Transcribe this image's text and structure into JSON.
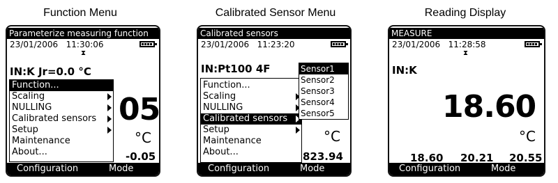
{
  "panels": [
    {
      "caption": "Function  Menu",
      "title": "Parameterize measuring function",
      "date": "23/01/2006",
      "time": "11:30:06",
      "input_line": "IN:K Jr=0.0 °C",
      "menu": [
        {
          "label": "Function...",
          "selected": true,
          "arrow": false
        },
        {
          "label": "Scaling",
          "selected": false,
          "arrow": true
        },
        {
          "label": "NULLING",
          "selected": false,
          "arrow": true
        },
        {
          "label": "Calibrated sensors",
          "selected": false,
          "arrow": true
        },
        {
          "label": "Setup",
          "selected": false,
          "arrow": true
        },
        {
          "label": "Maintenance",
          "selected": false,
          "arrow": false
        },
        {
          "label": "About...",
          "selected": false,
          "arrow": false
        }
      ],
      "reading": "05",
      "unit": "°C",
      "secondary": "-0.05",
      "softkeys": [
        "Configuration",
        "Mode"
      ]
    },
    {
      "caption": "Calibrated Sensor Menu",
      "title": "Calibrated sensors",
      "date": "23/01/2006",
      "time": "11:23:20",
      "input_line": "IN:Pt100 4F",
      "menu": [
        {
          "label": "Function...",
          "selected": false,
          "arrow": false
        },
        {
          "label": "Scaling",
          "selected": false,
          "arrow": true
        },
        {
          "label": "NULLING",
          "selected": false,
          "arrow": true
        },
        {
          "label": "Calibrated sensors",
          "selected": true,
          "arrow": true
        },
        {
          "label": "Setup",
          "selected": false,
          "arrow": true
        },
        {
          "label": "Maintenance",
          "selected": false,
          "arrow": false
        },
        {
          "label": "About...",
          "selected": false,
          "arrow": false
        }
      ],
      "submenu": [
        "Sensor1",
        "Sensor2",
        "Sensor3",
        "Sensor4",
        "Sensor5"
      ],
      "submenu_selected": 0,
      "unit": "°C",
      "secondary": "823.94",
      "softkeys": [
        "Configuration",
        "Mode"
      ]
    },
    {
      "caption": "Reading Display",
      "title": "MEASURE",
      "date": "23/01/2006",
      "time": "11:28:58",
      "input_line": "IN:K",
      "reading": "18.60",
      "unit": "°C",
      "stats": [
        "18.60",
        "20.21",
        "20.55"
      ],
      "softkeys": [
        "Configuration",
        "Mode"
      ]
    }
  ]
}
